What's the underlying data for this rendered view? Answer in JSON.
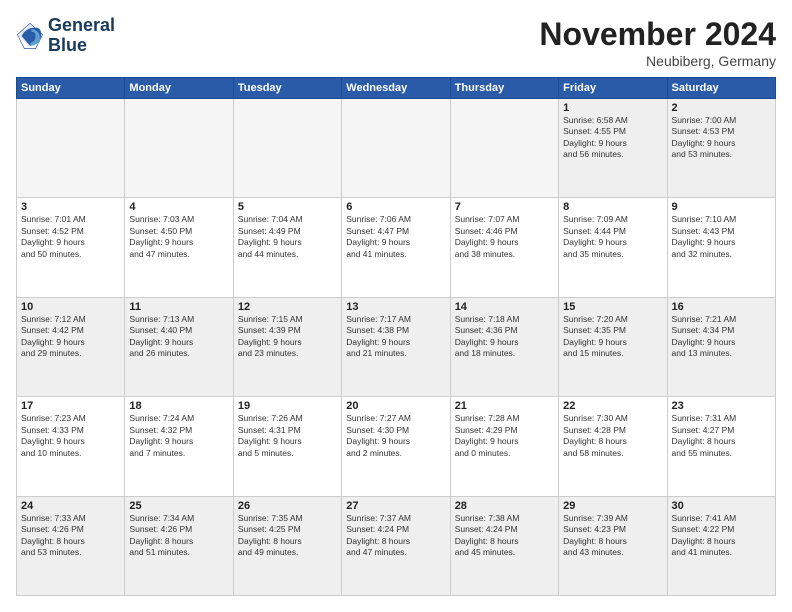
{
  "logo": {
    "line1": "General",
    "line2": "Blue"
  },
  "title": "November 2024",
  "location": "Neubiberg, Germany",
  "weekdays": [
    "Sunday",
    "Monday",
    "Tuesday",
    "Wednesday",
    "Thursday",
    "Friday",
    "Saturday"
  ],
  "weeks": [
    [
      {
        "day": "",
        "info": ""
      },
      {
        "day": "",
        "info": ""
      },
      {
        "day": "",
        "info": ""
      },
      {
        "day": "",
        "info": ""
      },
      {
        "day": "",
        "info": ""
      },
      {
        "day": "1",
        "info": "Sunrise: 6:58 AM\nSunset: 4:55 PM\nDaylight: 9 hours\nand 56 minutes."
      },
      {
        "day": "2",
        "info": "Sunrise: 7:00 AM\nSunset: 4:53 PM\nDaylight: 9 hours\nand 53 minutes."
      }
    ],
    [
      {
        "day": "3",
        "info": "Sunrise: 7:01 AM\nSunset: 4:52 PM\nDaylight: 9 hours\nand 50 minutes."
      },
      {
        "day": "4",
        "info": "Sunrise: 7:03 AM\nSunset: 4:50 PM\nDaylight: 9 hours\nand 47 minutes."
      },
      {
        "day": "5",
        "info": "Sunrise: 7:04 AM\nSunset: 4:49 PM\nDaylight: 9 hours\nand 44 minutes."
      },
      {
        "day": "6",
        "info": "Sunrise: 7:06 AM\nSunset: 4:47 PM\nDaylight: 9 hours\nand 41 minutes."
      },
      {
        "day": "7",
        "info": "Sunrise: 7:07 AM\nSunset: 4:46 PM\nDaylight: 9 hours\nand 38 minutes."
      },
      {
        "day": "8",
        "info": "Sunrise: 7:09 AM\nSunset: 4:44 PM\nDaylight: 9 hours\nand 35 minutes."
      },
      {
        "day": "9",
        "info": "Sunrise: 7:10 AM\nSunset: 4:43 PM\nDaylight: 9 hours\nand 32 minutes."
      }
    ],
    [
      {
        "day": "10",
        "info": "Sunrise: 7:12 AM\nSunset: 4:42 PM\nDaylight: 9 hours\nand 29 minutes."
      },
      {
        "day": "11",
        "info": "Sunrise: 7:13 AM\nSunset: 4:40 PM\nDaylight: 9 hours\nand 26 minutes."
      },
      {
        "day": "12",
        "info": "Sunrise: 7:15 AM\nSunset: 4:39 PM\nDaylight: 9 hours\nand 23 minutes."
      },
      {
        "day": "13",
        "info": "Sunrise: 7:17 AM\nSunset: 4:38 PM\nDaylight: 9 hours\nand 21 minutes."
      },
      {
        "day": "14",
        "info": "Sunrise: 7:18 AM\nSunset: 4:36 PM\nDaylight: 9 hours\nand 18 minutes."
      },
      {
        "day": "15",
        "info": "Sunrise: 7:20 AM\nSunset: 4:35 PM\nDaylight: 9 hours\nand 15 minutes."
      },
      {
        "day": "16",
        "info": "Sunrise: 7:21 AM\nSunset: 4:34 PM\nDaylight: 9 hours\nand 13 minutes."
      }
    ],
    [
      {
        "day": "17",
        "info": "Sunrise: 7:23 AM\nSunset: 4:33 PM\nDaylight: 9 hours\nand 10 minutes."
      },
      {
        "day": "18",
        "info": "Sunrise: 7:24 AM\nSunset: 4:32 PM\nDaylight: 9 hours\nand 7 minutes."
      },
      {
        "day": "19",
        "info": "Sunrise: 7:26 AM\nSunset: 4:31 PM\nDaylight: 9 hours\nand 5 minutes."
      },
      {
        "day": "20",
        "info": "Sunrise: 7:27 AM\nSunset: 4:30 PM\nDaylight: 9 hours\nand 2 minutes."
      },
      {
        "day": "21",
        "info": "Sunrise: 7:28 AM\nSunset: 4:29 PM\nDaylight: 9 hours\nand 0 minutes."
      },
      {
        "day": "22",
        "info": "Sunrise: 7:30 AM\nSunset: 4:28 PM\nDaylight: 8 hours\nand 58 minutes."
      },
      {
        "day": "23",
        "info": "Sunrise: 7:31 AM\nSunset: 4:27 PM\nDaylight: 8 hours\nand 55 minutes."
      }
    ],
    [
      {
        "day": "24",
        "info": "Sunrise: 7:33 AM\nSunset: 4:26 PM\nDaylight: 8 hours\nand 53 minutes."
      },
      {
        "day": "25",
        "info": "Sunrise: 7:34 AM\nSunset: 4:26 PM\nDaylight: 8 hours\nand 51 minutes."
      },
      {
        "day": "26",
        "info": "Sunrise: 7:35 AM\nSunset: 4:25 PM\nDaylight: 8 hours\nand 49 minutes."
      },
      {
        "day": "27",
        "info": "Sunrise: 7:37 AM\nSunset: 4:24 PM\nDaylight: 8 hours\nand 47 minutes."
      },
      {
        "day": "28",
        "info": "Sunrise: 7:38 AM\nSunset: 4:24 PM\nDaylight: 8 hours\nand 45 minutes."
      },
      {
        "day": "29",
        "info": "Sunrise: 7:39 AM\nSunset: 4:23 PM\nDaylight: 8 hours\nand 43 minutes."
      },
      {
        "day": "30",
        "info": "Sunrise: 7:41 AM\nSunset: 4:22 PM\nDaylight: 8 hours\nand 41 minutes."
      }
    ]
  ]
}
